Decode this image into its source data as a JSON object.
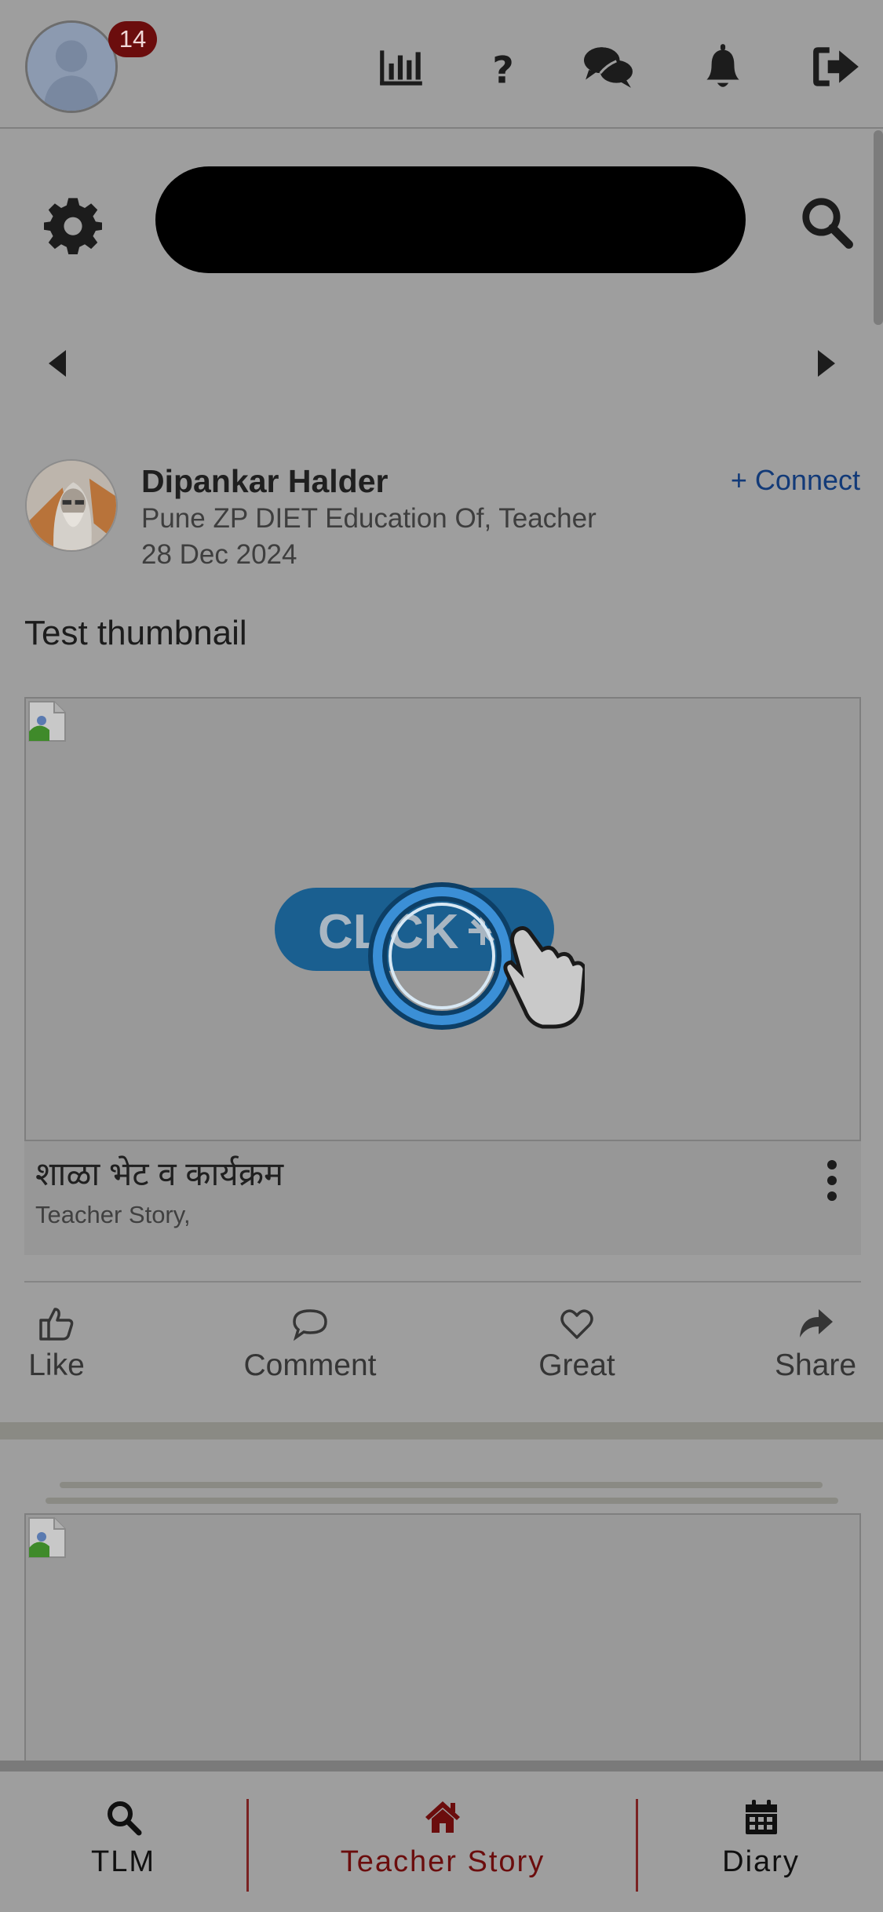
{
  "header": {
    "notification_badge": "14",
    "icons": [
      "chart-icon",
      "help-icon",
      "chat-icon",
      "bell-icon",
      "logout-icon"
    ]
  },
  "search": {
    "value": "",
    "placeholder": ""
  },
  "post": {
    "author_name": "Dipankar Halder",
    "author_role": "Pune ZP DIET Education Of, Teacher",
    "date": "28 Dec 2024",
    "connect_label": "+ Connect",
    "text": "Test thumbnail",
    "media_title": "शाळा भेट व कार्यक्रम",
    "media_subtitle": "Teacher Story,",
    "actions": {
      "like": "Like",
      "comment": "Comment",
      "great": "Great",
      "share": "Share"
    }
  },
  "bottom_nav": {
    "items": [
      {
        "label": "TLM",
        "icon": "search-icon"
      },
      {
        "label": "Teacher Story",
        "icon": "home-icon",
        "active": true
      },
      {
        "label": "Diary",
        "icon": "calendar-icon"
      }
    ]
  },
  "colors": {
    "accent": "#6b0d0d",
    "link": "#123a78",
    "overlay_bg": "#9e9e9e"
  }
}
